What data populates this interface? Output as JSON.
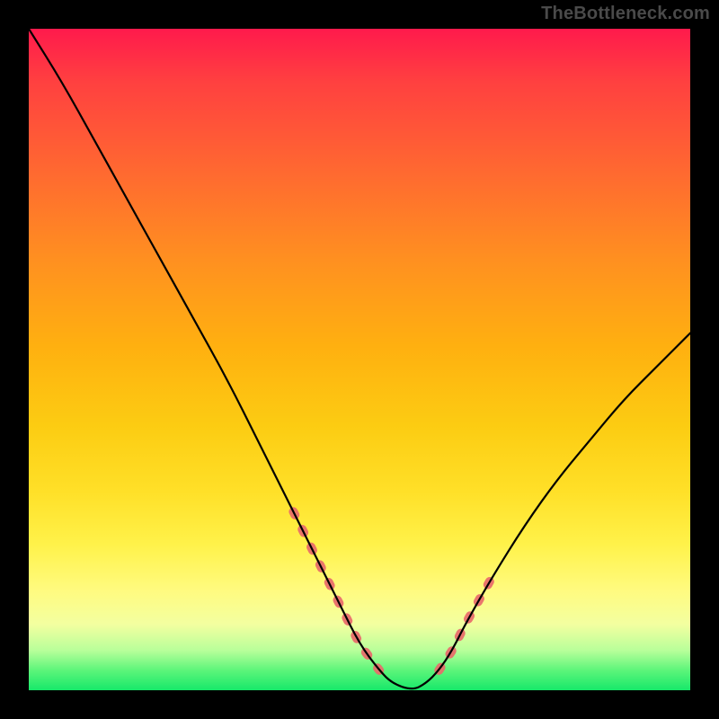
{
  "attribution": "TheBottleneck.com",
  "chart_data": {
    "type": "line",
    "title": "",
    "xlabel": "",
    "ylabel": "",
    "xlim": [
      0,
      100
    ],
    "ylim": [
      0,
      100
    ],
    "series": [
      {
        "name": "bottleneck-curve",
        "x": [
          0,
          5,
          10,
          15,
          20,
          25,
          30,
          35,
          40,
          45,
          47,
          50,
          53,
          55,
          58,
          60,
          62,
          64,
          66,
          70,
          75,
          80,
          85,
          90,
          95,
          100
        ],
        "values": [
          100,
          92,
          83,
          74,
          65,
          56,
          47,
          37,
          27,
          17,
          13,
          7,
          3,
          1,
          0,
          1,
          3,
          6,
          10,
          17,
          25,
          32,
          38,
          44,
          49,
          54
        ]
      }
    ],
    "highlight_segments": [
      {
        "x_start": 40,
        "x_end": 53,
        "side": "left"
      },
      {
        "x_start": 62,
        "x_end": 70,
        "side": "right"
      }
    ],
    "gradient_stops": [
      {
        "pct": 0,
        "color": "#ff1a4c"
      },
      {
        "pct": 35,
        "color": "#ff9020"
      },
      {
        "pct": 70,
        "color": "#ffe028"
      },
      {
        "pct": 90,
        "color": "#f3ffa0"
      },
      {
        "pct": 100,
        "color": "#17e86a"
      }
    ],
    "highlight_color": "#e86a6a",
    "curve_color": "#000000"
  }
}
